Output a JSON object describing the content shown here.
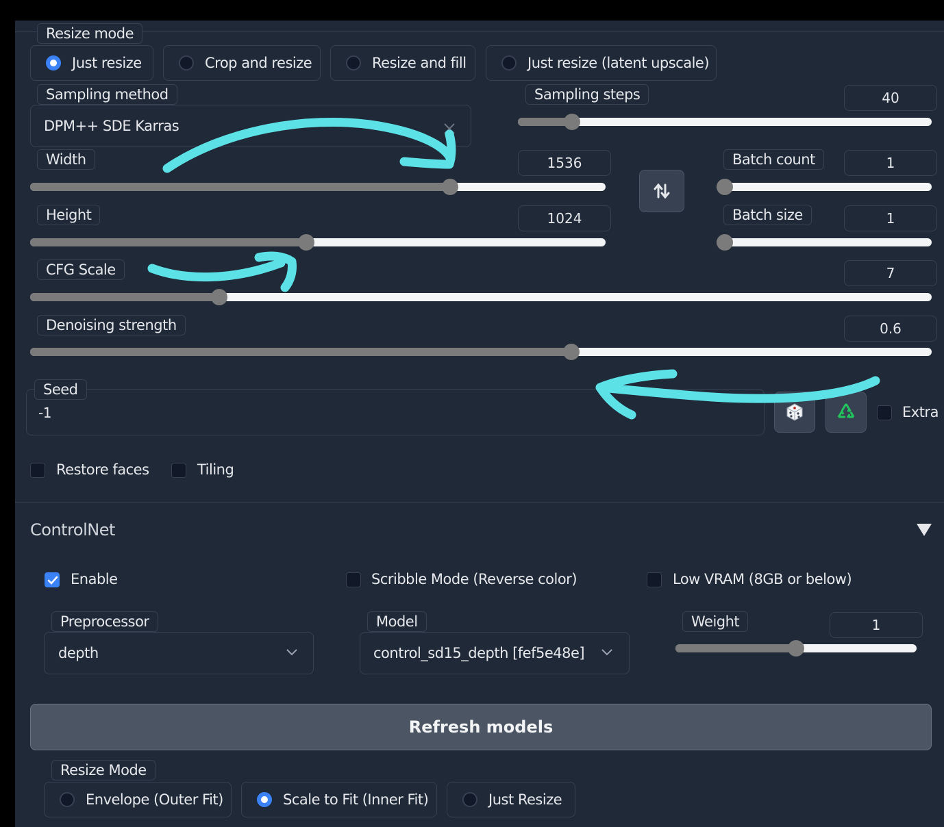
{
  "resize_mode": {
    "label": "Resize mode",
    "options": [
      "Just resize",
      "Crop and resize",
      "Resize and fill",
      "Just resize (latent upscale)"
    ],
    "selected": "Just resize"
  },
  "sampling": {
    "method_label": "Sampling method",
    "method_value": "DPM++ SDE Karras",
    "steps_label": "Sampling steps",
    "steps_value": "40",
    "steps_fraction": 0.13
  },
  "width": {
    "label": "Width",
    "value": "1536",
    "fraction": 0.73
  },
  "height": {
    "label": "Height",
    "value": "1024",
    "fraction": 0.48
  },
  "batch_count": {
    "label": "Batch count",
    "value": "1",
    "fraction": 0
  },
  "batch_size": {
    "label": "Batch size",
    "value": "1",
    "fraction": 0
  },
  "cfg_scale": {
    "label": "CFG Scale",
    "value": "7",
    "fraction": 0.21
  },
  "denoising": {
    "label": "Denoising strength",
    "value": "0.6",
    "fraction": 0.6
  },
  "seed": {
    "label": "Seed",
    "value": "-1",
    "extra_label": "Extra"
  },
  "options": {
    "restore_faces": "Restore faces",
    "tiling": "Tiling"
  },
  "controlnet": {
    "title": "ControlNet",
    "enable_label": "Enable",
    "enable_checked": true,
    "scribble_label": "Scribble Mode (Reverse color)",
    "low_vram_label": "Low VRAM (8GB or below)",
    "preprocessor_label": "Preprocessor",
    "preprocessor_value": "depth",
    "model_label": "Model",
    "model_value": "control_sd15_depth [fef5e48e]",
    "weight_label": "Weight",
    "weight_value": "1",
    "weight_fraction": 0.5,
    "refresh_label": "Refresh models",
    "resize_mode_label": "Resize Mode",
    "resize_options": [
      "Envelope (Outer Fit)",
      "Scale to Fit (Inner Fit)",
      "Just Resize"
    ],
    "resize_selected": "Scale to Fit (Inner Fit)"
  },
  "colors": {
    "background": "#1f2937",
    "accent": "#3b82f6",
    "annotation_arrow": "#5ce1e6",
    "slider_fill": "#7b7b7b"
  },
  "icons": [
    "swap-dimensions-icon",
    "random-seed-dice-icon",
    "reuse-seed-recycle-icon",
    "collapse-triangle-icon",
    "dropdown-chevron-icon",
    "clear-x-icon"
  ]
}
